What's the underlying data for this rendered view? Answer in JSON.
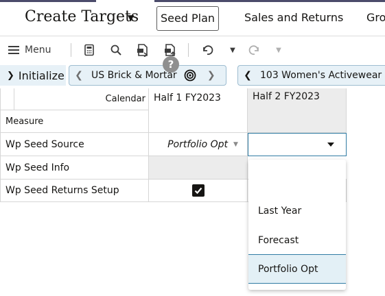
{
  "header": {
    "app_title": "Create Targets",
    "tabs": [
      {
        "label": "Seed Plan",
        "active": true
      },
      {
        "label": "Sales and Returns",
        "active": false
      },
      {
        "label": "Gro",
        "active": false
      }
    ]
  },
  "toolbar": {
    "menu_label": "Menu",
    "icons": [
      "calculator-icon",
      "search-icon",
      "export-icon",
      "import-icon",
      "undo-icon",
      "redo-icon"
    ],
    "help_badge": "?"
  },
  "context": {
    "initialize_label": "Initialize",
    "location_label": "US Brick & Mortar",
    "product_label": "103 Women's Activewear"
  },
  "grid": {
    "calendar_label": "Calendar",
    "measure_label": "Measure",
    "columns": [
      "Half 1 FY2023",
      "Half 2 FY2023"
    ],
    "rows": [
      {
        "label": "Wp Seed Source",
        "half1": "Portfolio Opt",
        "half2": ""
      },
      {
        "label": "Wp Seed Info",
        "half1": "",
        "half2": ""
      },
      {
        "label": "Wp Seed Returns Setup",
        "half1_checked": true
      }
    ]
  },
  "dropdown": {
    "options": [
      "",
      "Last Year",
      "Forecast",
      "Portfolio Opt"
    ],
    "selected": "Portfolio Opt"
  },
  "colors": {
    "accent": "#2f7ba3",
    "context_bg": "#e7f1f7",
    "selected_bg": "#e3f0f6",
    "disabled_cell": "#ececec"
  }
}
